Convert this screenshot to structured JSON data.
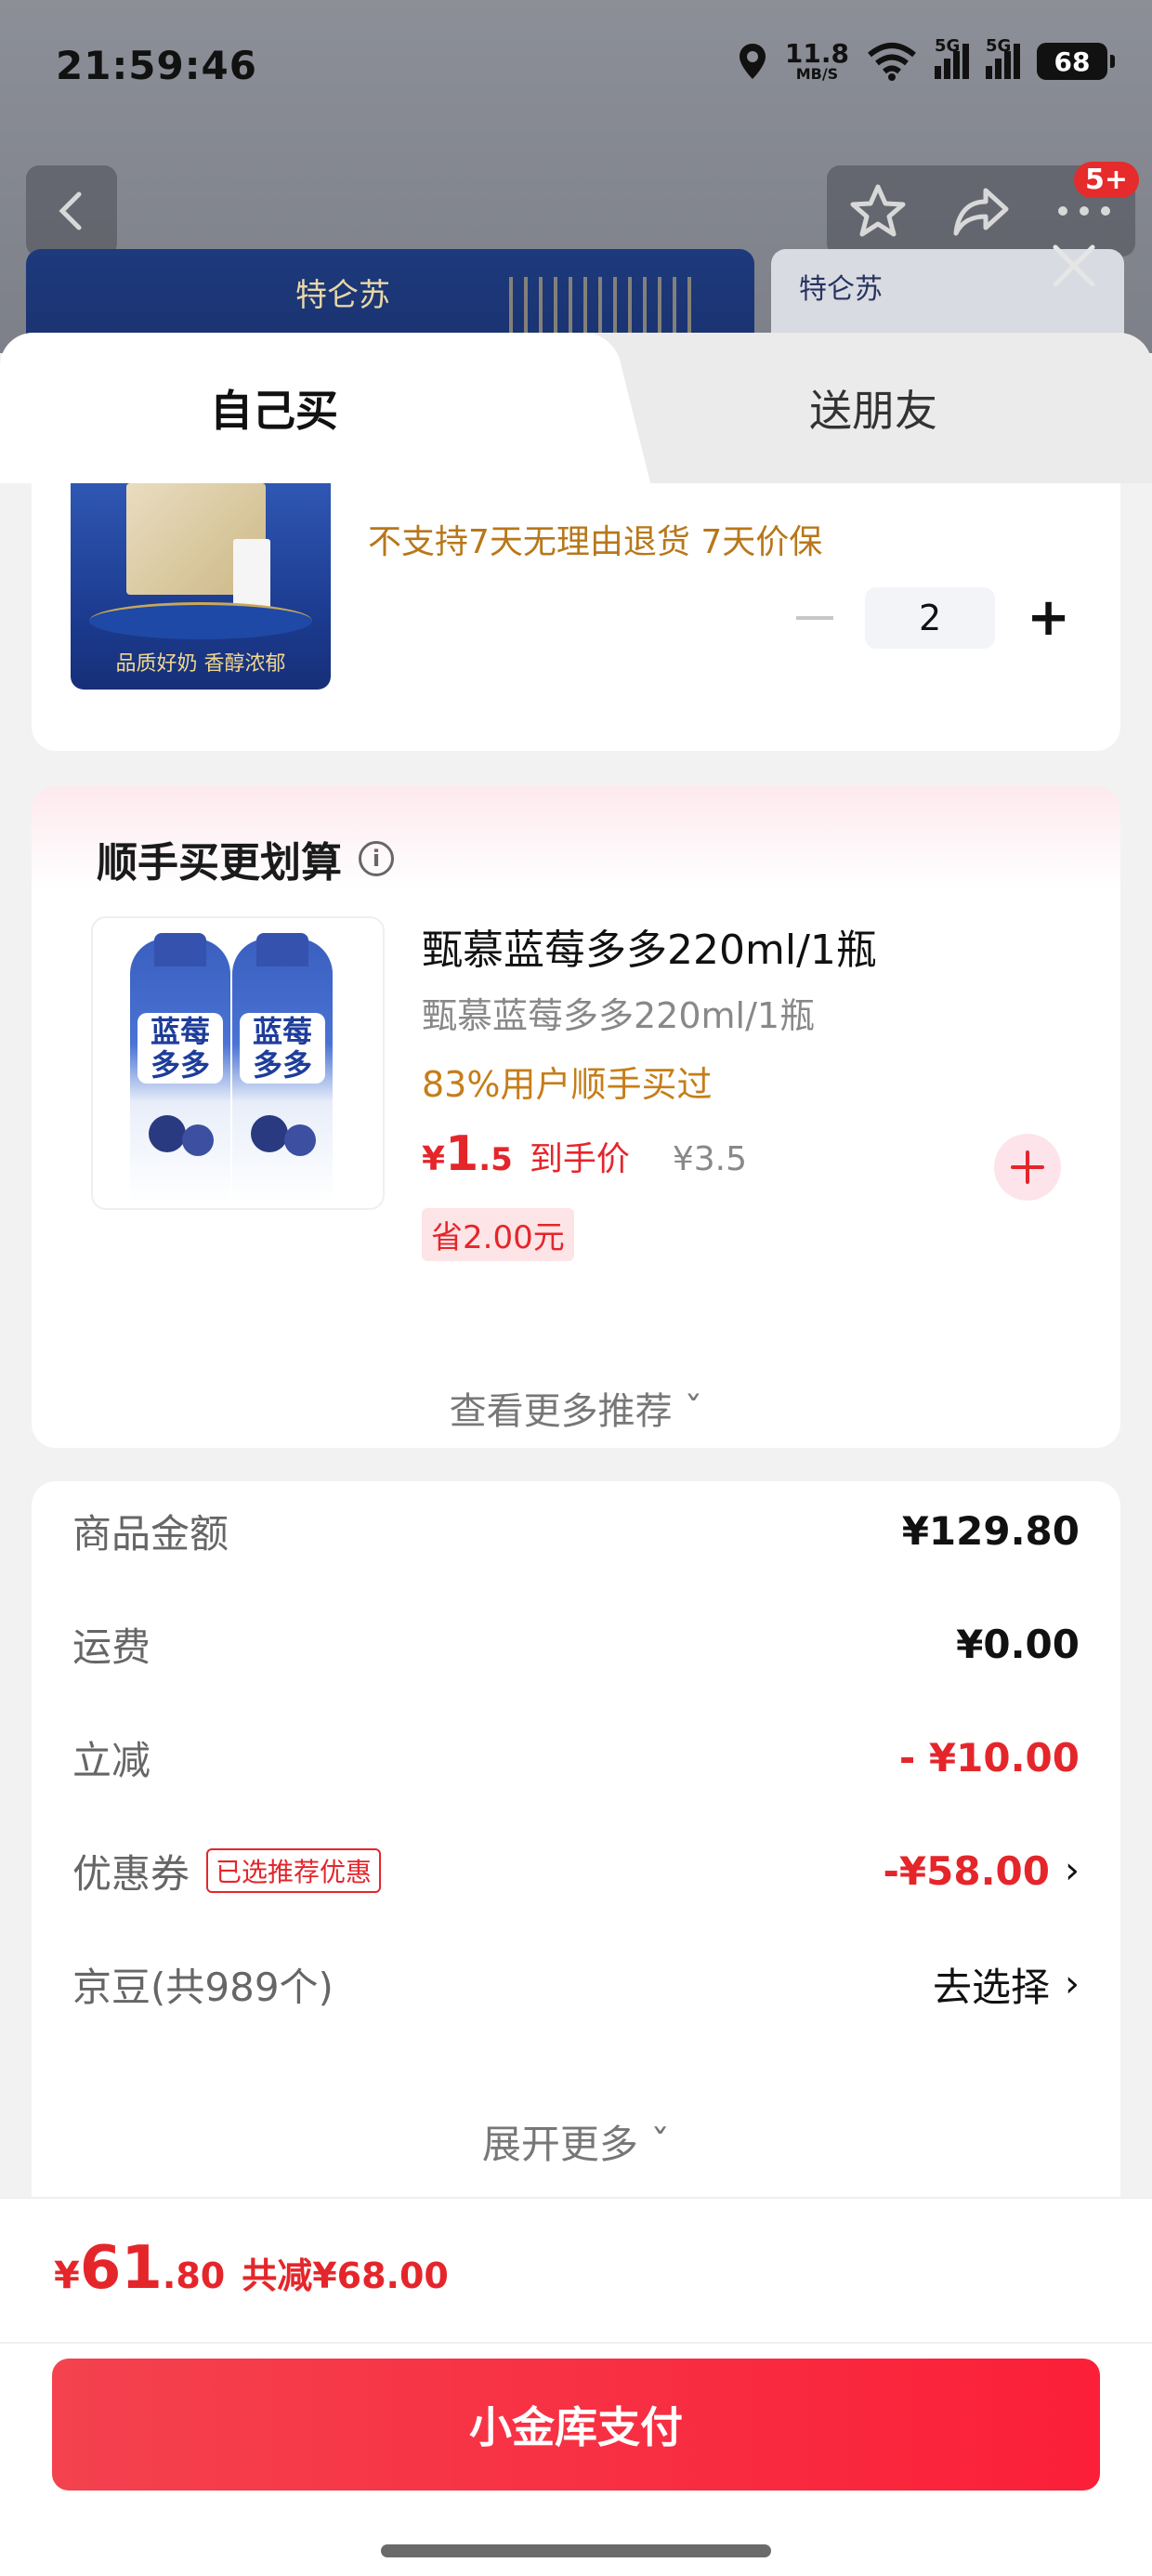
{
  "status_bar": {
    "time": "21:59:46",
    "net_speed": "11.8",
    "net_unit": "MB/S",
    "signal1": "5G",
    "signal2": "5G",
    "battery": "68"
  },
  "header": {
    "badge": "5+",
    "brand_left": "特仑苏",
    "brand_right": "特仑苏"
  },
  "tabs": {
    "self_buy": "自己买",
    "gift": "送朋友"
  },
  "product": {
    "policy": "不支持7天无理由退货  7天价保",
    "quantity": "2",
    "image_tagline": "品质好奶 香醇浓郁"
  },
  "recommendation": {
    "title": "顺手买更划算",
    "name": "甄慕蓝莓多多220ml/1瓶",
    "sub": "甄慕蓝莓多多220ml/1瓶",
    "bought": "83%用户顺手买过",
    "price_currency": "¥",
    "price_int": "1",
    "price_dec": ".5",
    "price_label": "到手价",
    "price_orig": "¥3.5",
    "save_tag": "省2.00元",
    "bottle_label": "蓝莓多多",
    "more": "查看更多推荐 ˇ"
  },
  "details": {
    "goods_label": "商品金额",
    "goods_value": "¥129.80",
    "shipping_label": "运费",
    "shipping_value": "¥0.00",
    "discount_label": "立减",
    "discount_value": "- ¥10.00",
    "coupon_label": "优惠券",
    "coupon_chip": "已选推荐优惠",
    "coupon_value": "-¥58.00",
    "beans_label": "京豆(共989个)",
    "beans_value": "去选择",
    "expand": "展开更多 ˇ"
  },
  "bottom": {
    "total_currency": "¥",
    "total_int": "61",
    "total_dec": ".80",
    "total_saved": "共减¥68.00",
    "pay_button": "小金库支付"
  },
  "colors": {
    "accent_red": "#e4262b",
    "gold_text": "#b8771a",
    "pay_button": "#fb1f38"
  }
}
